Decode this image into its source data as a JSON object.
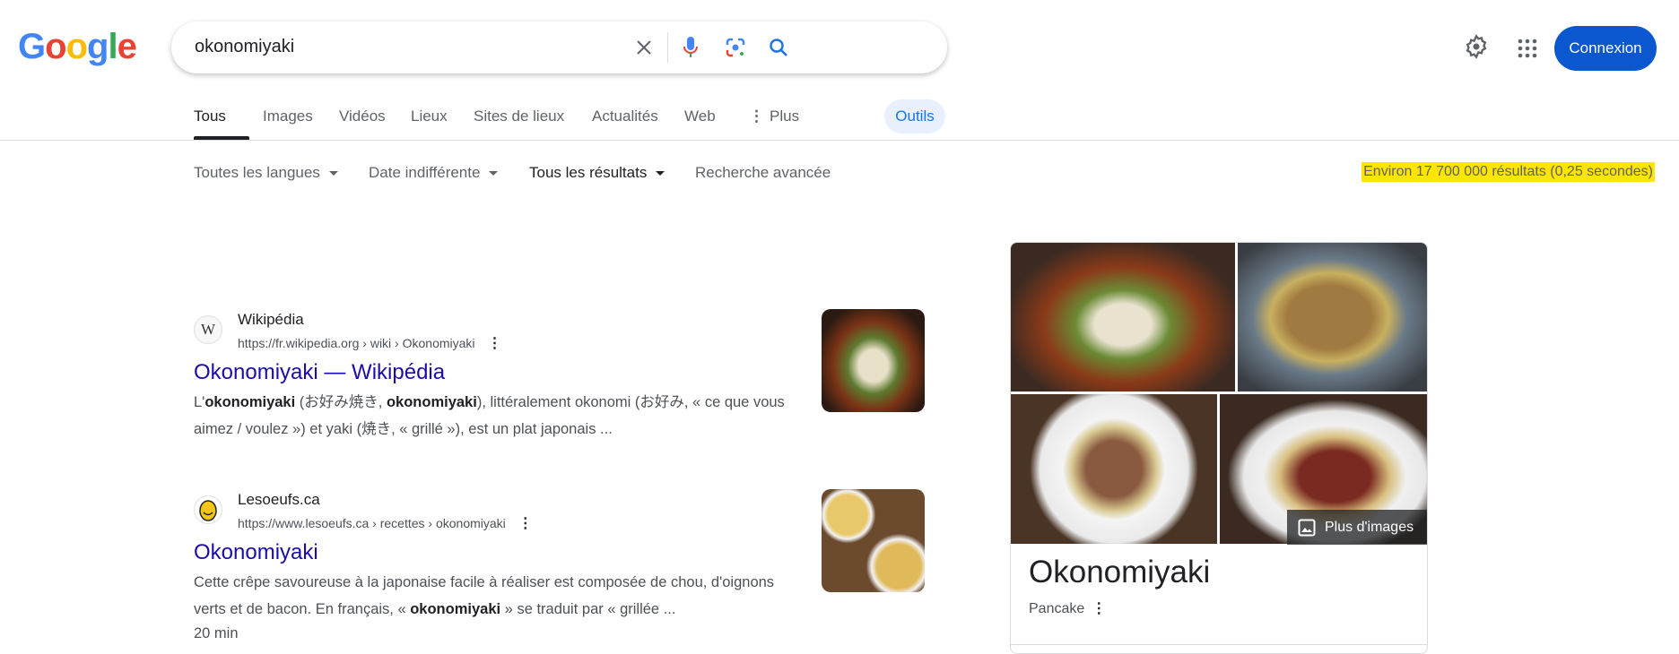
{
  "header": {
    "logo": "Google",
    "search": {
      "query": "okonomiyaki"
    },
    "connexion_label": "Connexion"
  },
  "tabs": [
    {
      "label": "Tous",
      "active": true
    },
    {
      "label": "Images"
    },
    {
      "label": "Vidéos"
    },
    {
      "label": "Lieux"
    },
    {
      "label": "Sites de lieux"
    },
    {
      "label": "Actualités"
    },
    {
      "label": "Web"
    },
    {
      "label": "Plus"
    }
  ],
  "tools_label": "Outils",
  "filters": [
    {
      "label": "Toutes les langues"
    },
    {
      "label": "Date indifférente"
    },
    {
      "label": "Tous les résultats"
    },
    {
      "label": "Recherche avancée"
    }
  ],
  "result_stats": "Environ 17 700 000 résultats (0,25 secondes)",
  "colors": {
    "link": "#1a0dab",
    "accent": "#0b57d0",
    "highlight": "#ffe500"
  },
  "results": [
    {
      "site": "Wikipédia",
      "url": "https://fr.wikipedia.org › wiki › Okonomiyaki",
      "title": "Okonomiyaki — Wikipédia",
      "snippet_parts": [
        "L'",
        "okonomiyaki",
        " (お好み焼き, ",
        "okonomiyaki",
        "), littéralement okonomi (お好み, « ce que vous aimez / voulez ») et yaki (焼き, « grillé »), est un plat japonais ..."
      ]
    },
    {
      "site": "Lesoeufs.ca",
      "url": "https://www.lesoeufs.ca › recettes › okonomiyaki",
      "title": "Okonomiyaki",
      "snippet_parts": [
        "Cette crêpe savoureuse à la japonaise facile à réaliser est composée de chou, d'oignons verts et de bacon. En français, « ",
        "okonomiyaki",
        " » se traduit par « grillée ..."
      ],
      "meta": "20 min"
    }
  ],
  "knowledge_panel": {
    "title": "Okonomiyaki",
    "subtitle": "Pancake",
    "more_images_label": "Plus d'images"
  }
}
